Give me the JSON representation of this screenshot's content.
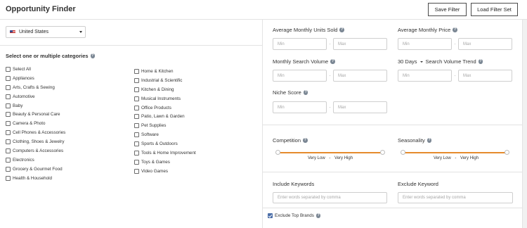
{
  "header": {
    "title": "Opportunity Finder",
    "save_filter_label": "Save Filter",
    "load_filter_set_label": "Load Filter Set"
  },
  "country": {
    "selected": "United States",
    "flag_icon": "us-flag-icon"
  },
  "categories": {
    "heading": "Select one or multiple categories",
    "column_1": [
      "Select All",
      "Appliances",
      "Arts, Crafts & Sewing",
      "Automotive",
      "Baby",
      "Beauty & Personal Care",
      "Camera & Photo",
      "Cell Phones & Accessories",
      "Clothing, Shoes & Jewelry",
      "Computers & Accessories",
      "Electronics",
      "Grocery & Gourmet Food",
      "Health & Household"
    ],
    "column_2": [
      "Home & Kitchen",
      "Industrial & Scientific",
      "Kitchen & Dining",
      "Musical Instruments",
      "Office Products",
      "Patio, Lawn & Garden",
      "Pet Supplies",
      "Software",
      "Sports & Outdoors",
      "Tools & Home Improvement",
      "Toys & Games",
      "Video Games"
    ]
  },
  "filters": {
    "units_sold": {
      "label": "Average Monthly Units Sold",
      "min_placeholder": "Min",
      "max_placeholder": "Max"
    },
    "price": {
      "label": "Average Monthly Price",
      "min_placeholder": "Min",
      "max_placeholder": "Max"
    },
    "search_volume": {
      "label": "Monthly Search Volume",
      "min_placeholder": "Min",
      "max_placeholder": "Max"
    },
    "trend": {
      "period": "30 Days",
      "label": "Search Volume Trend",
      "min_placeholder": "Min",
      "max_placeholder": "Max"
    },
    "niche_score": {
      "label": "Niche Score",
      "min_placeholder": "Min",
      "max_placeholder": "Max"
    },
    "separator": "-"
  },
  "sliders": {
    "competition": {
      "label": "Competition",
      "low": "Very Low",
      "sep": "-",
      "high": "Very High"
    },
    "seasonality": {
      "label": "Seasonality",
      "low": "Very Low",
      "sep": "-",
      "high": "Very High"
    }
  },
  "keywords": {
    "include_label": "Include Keywords",
    "include_placeholder": "Enter words separated by comma",
    "exclude_label": "Exclude Keyword",
    "exclude_placeholder": "Enter words separated by comma"
  },
  "exclude_brands": {
    "label": "Exclude Top Brands",
    "checked": true
  },
  "colors": {
    "slider_accent": "#e58b2d",
    "checkbox_checked": "#4b6ea8",
    "help_icon": "#7b8794"
  }
}
